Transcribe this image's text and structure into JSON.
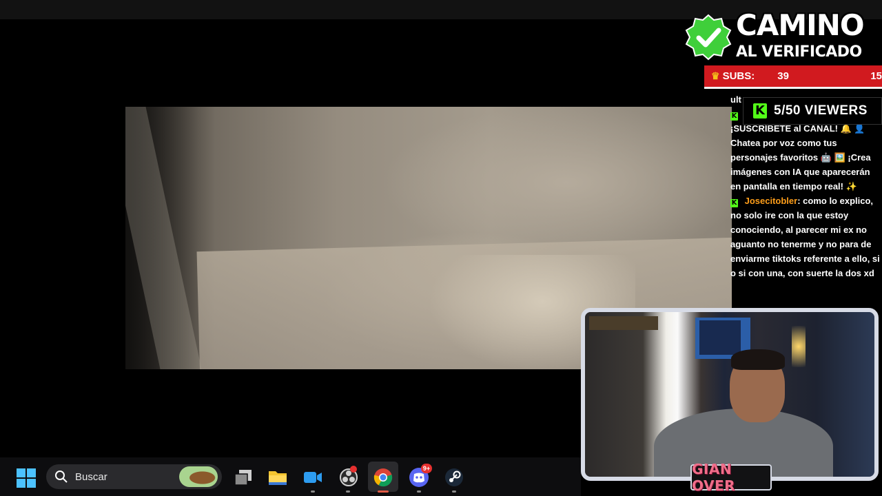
{
  "overlay": {
    "title_line1": "CAMINO",
    "title_line2": "AL VERIFICADO",
    "subs_label": "SUBS:",
    "subs_current": "39",
    "subs_goal": "15",
    "viewers_text": "5/50 VIEWERS",
    "kick_glyph": "K",
    "nameplate": "GIAN OVER",
    "brand_color": "#53fc18",
    "bar_color": "#d11a1f",
    "username_color": "#ff9e1a"
  },
  "chat": {
    "partial_line": "ult",
    "promo_text": "¡SUSCRÍBETE al CANAL! 🔔 👤 Chatea por voz como tus personajes favoritos 🤖 🖼️ ¡Crea imágenes con IA que aparecerán en pantalla en tiempo real! ✨",
    "message_user": "Josecitobler",
    "message_text": ": como lo explico, no solo ire con la que estoy conociendo, al parecer mi ex no aguanto no tenerme y no para de enviarme tiktoks referente a ello, si o si con una, con suerte la dos xd"
  },
  "taskbar": {
    "search_placeholder": "Buscar",
    "discord_badge": "9+",
    "icons": [
      "windows-start-icon",
      "task-view-icon",
      "file-explorer-icon",
      "video-app-icon",
      "obs-icon",
      "chrome-icon",
      "discord-icon",
      "steam-icon"
    ]
  }
}
